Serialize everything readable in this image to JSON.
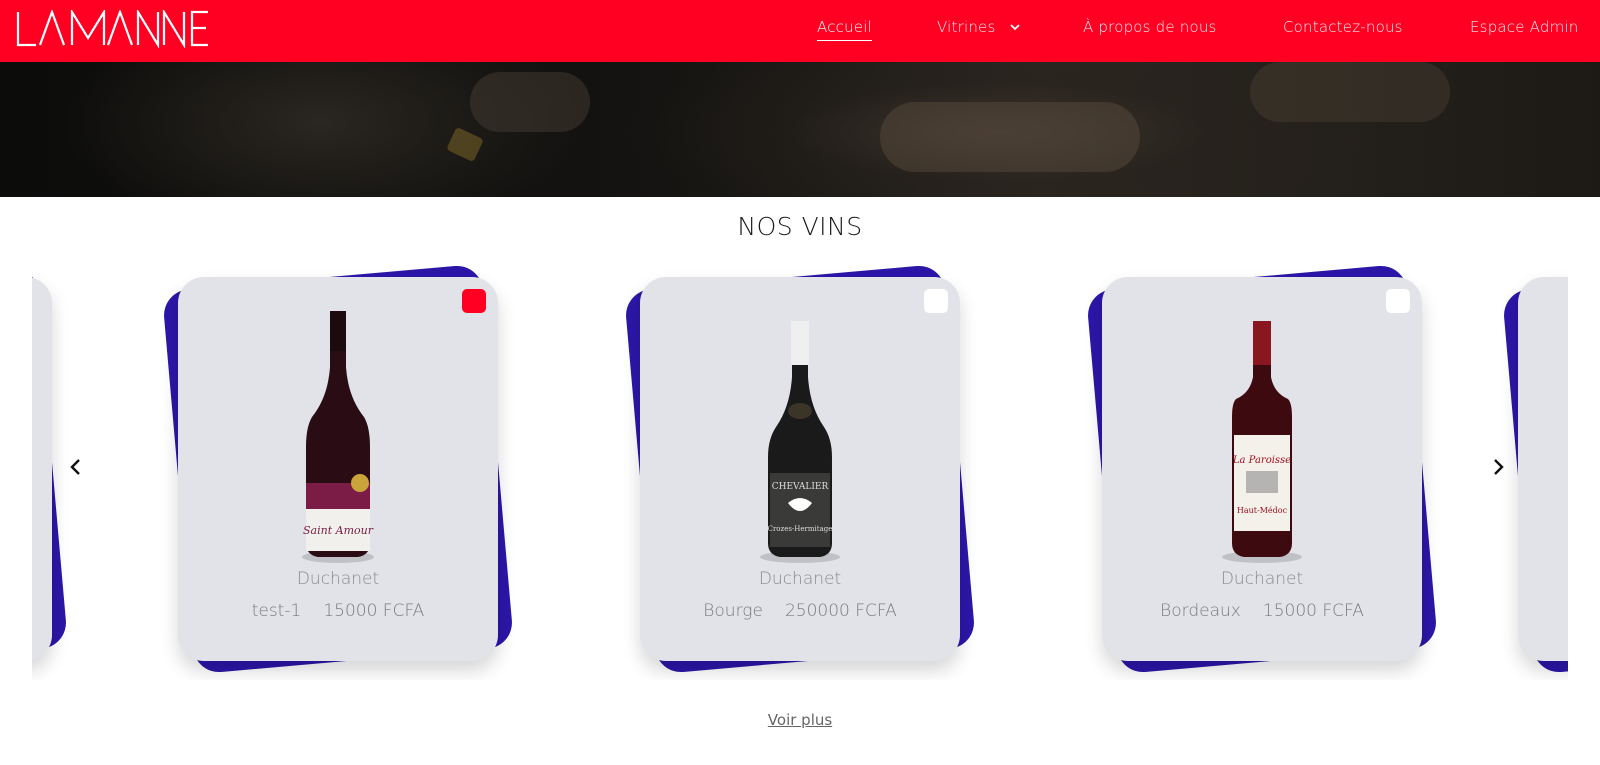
{
  "nav": {
    "logo_text": "LA MANNE",
    "items": [
      {
        "label": "Accueil",
        "active": true
      },
      {
        "label": "Vitrines",
        "has_dropdown": true
      },
      {
        "label": "À propos de nous"
      },
      {
        "label": "Contactez-nous"
      },
      {
        "label": "Espace Admin"
      }
    ]
  },
  "section": {
    "title": "NOS VINS",
    "more_link": "Voir plus"
  },
  "products": [
    {
      "brand": "Duchanet",
      "name": "test-1",
      "price": "15000 FCFA",
      "favorite": true,
      "bottle": "red-burgundy-bottle"
    },
    {
      "brand": "Duchanet",
      "name": "Bourge",
      "price": "250000 FCFA",
      "favorite": false,
      "bottle": "dark-rhone-bottle"
    },
    {
      "brand": "Duchanet",
      "name": "Bordeaux",
      "price": "15000 FCFA",
      "favorite": false,
      "bottle": "bordeaux-bottle"
    }
  ],
  "colors": {
    "brand_red": "#ff0022",
    "card_back": "#2c16a8",
    "card_bg": "#e2e3e9"
  },
  "icons": {
    "prev": "chevron-left-icon",
    "next": "chevron-right-icon"
  }
}
